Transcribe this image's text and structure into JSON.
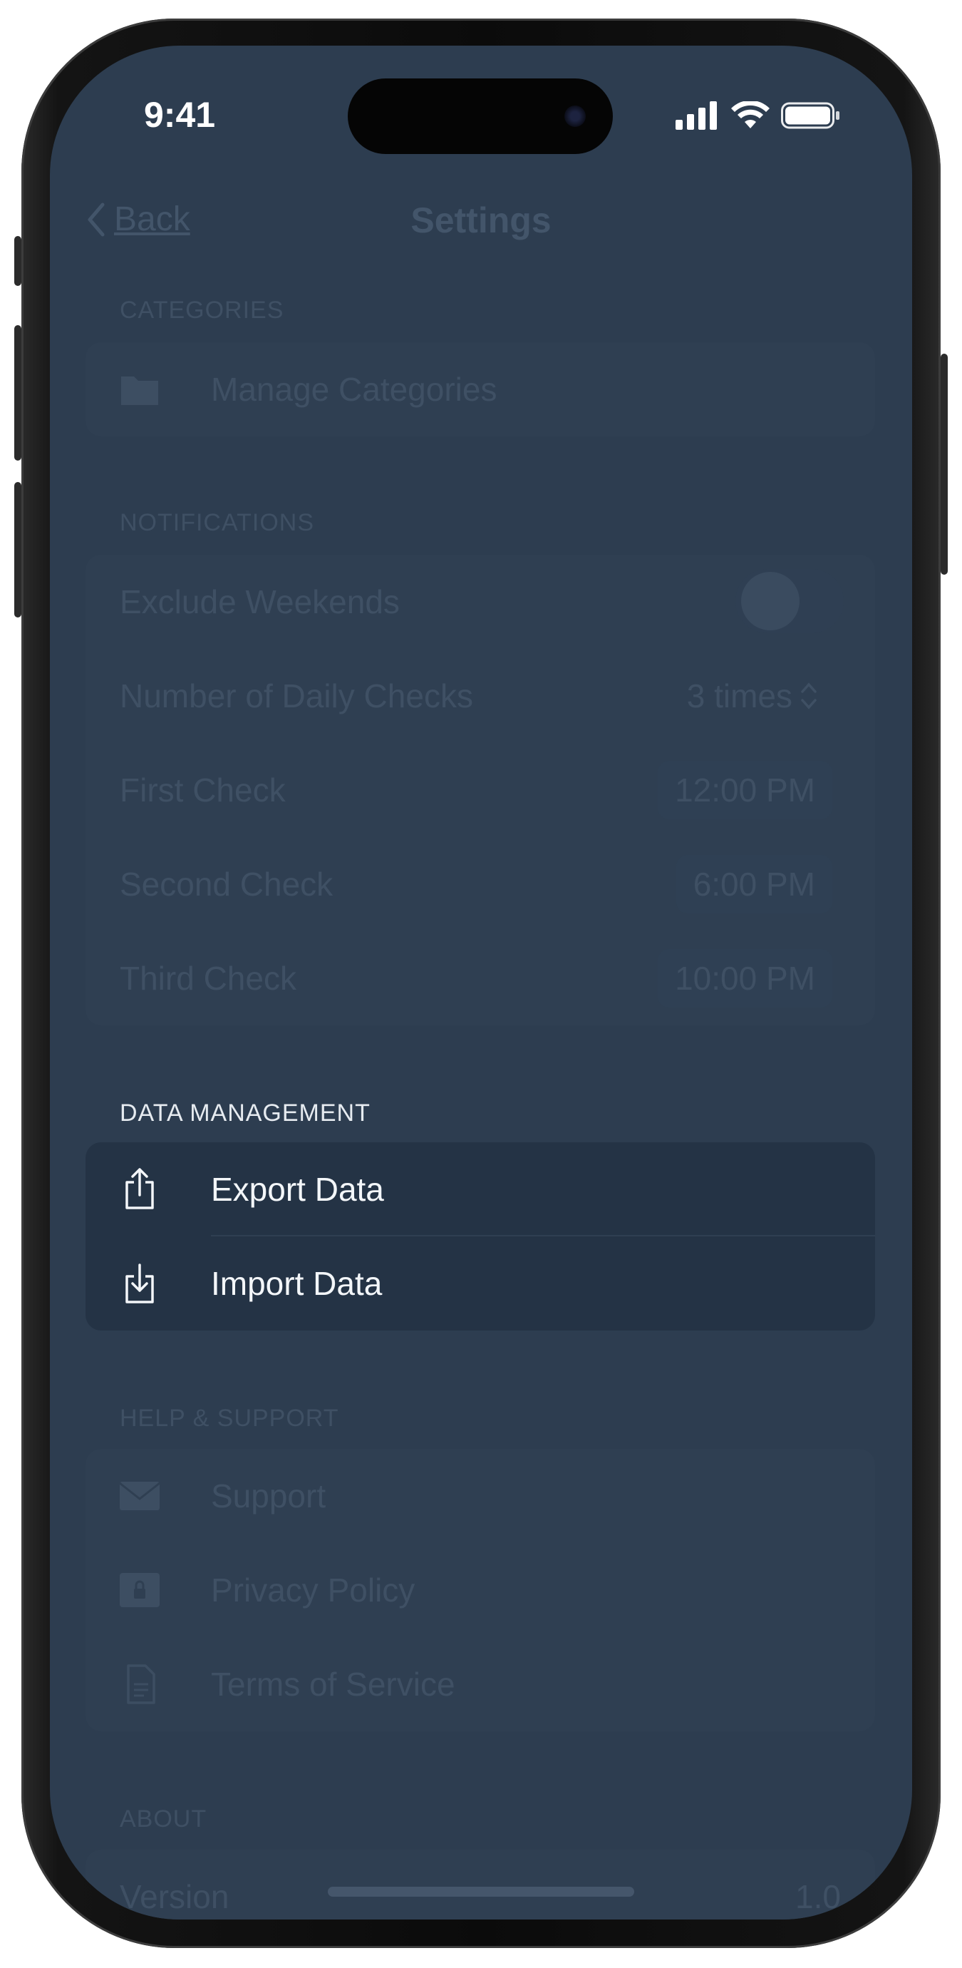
{
  "status_bar": {
    "time": "9:41"
  },
  "nav": {
    "back_label": "Back",
    "title": "Settings"
  },
  "categories": {
    "header": "CATEGORIES",
    "items": [
      {
        "label": "Manage Categories",
        "icon": "folder-icon"
      }
    ]
  },
  "notifications": {
    "header": "NOTIFICATIONS",
    "exclude_weekends": {
      "label": "Exclude Weekends",
      "enabled": false
    },
    "daily_checks": {
      "label": "Number of Daily Checks",
      "value": "3 times"
    },
    "first_check": {
      "label": "First Check",
      "value": "12:00 PM"
    },
    "second_check": {
      "label": "Second Check",
      "value": "6:00 PM"
    },
    "third_check": {
      "label": "Third Check",
      "value": "10:00 PM"
    }
  },
  "data_management": {
    "header": "DATA MANAGEMENT",
    "export": {
      "label": "Export Data",
      "icon": "share-export-icon"
    },
    "import": {
      "label": "Import Data",
      "icon": "import-tray-icon"
    }
  },
  "help_support": {
    "header": "HELP & SUPPORT",
    "support": {
      "label": "Support",
      "icon": "envelope-icon"
    },
    "privacy": {
      "label": "Privacy Policy",
      "icon": "lock-icon"
    },
    "terms": {
      "label": "Terms of Service",
      "icon": "document-icon"
    }
  },
  "about": {
    "header": "ABOUT",
    "version": {
      "label": "Version",
      "value": "1.0"
    }
  },
  "colors": {
    "screen_background": "#2d3d50",
    "active_group": "#243345",
    "dimmed_text": "#3f5064",
    "active_text": "#f3f6f9"
  }
}
